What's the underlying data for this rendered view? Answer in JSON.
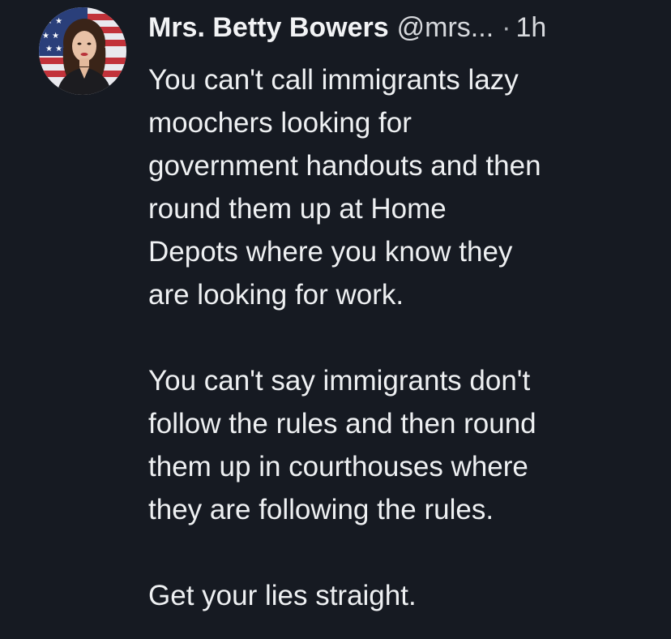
{
  "post": {
    "author_name": "Mrs. Betty Bowers",
    "author_handle": "@mrs...",
    "separator": "·",
    "timestamp": "1h",
    "paragraph_1": [
      "You can't call immigrants lazy",
      "moochers looking for",
      "government handouts and then",
      "round them up at Home",
      "Depots where you know they",
      "are looking for work."
    ],
    "paragraph_2": [
      "You can't say immigrants don't",
      "follow the rules and then round",
      "them up in courthouses where",
      "they are following the rules."
    ],
    "paragraph_3": [
      "Get your lies straight."
    ]
  },
  "colors": {
    "background": "#161a22",
    "text": "#eef0f2",
    "muted": "#d7d9dd"
  }
}
